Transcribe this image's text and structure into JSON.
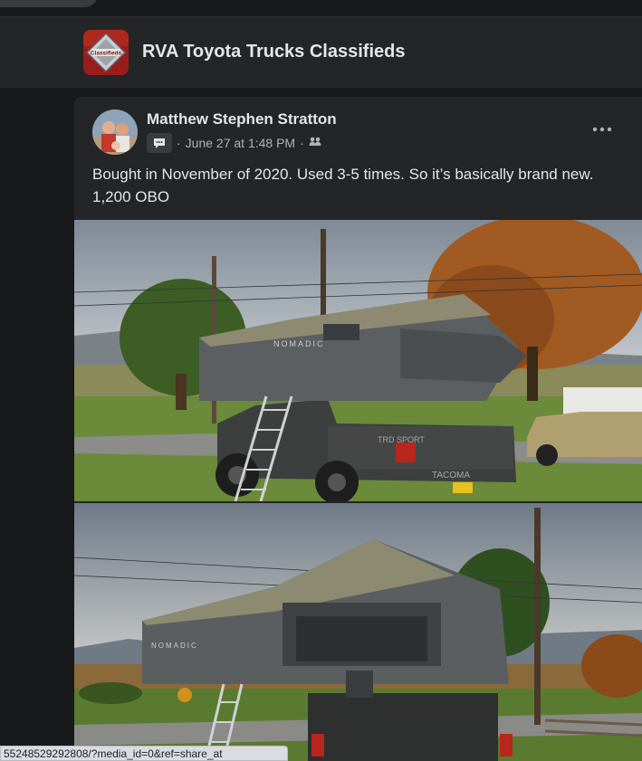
{
  "group": {
    "name": "RVA Toyota Trucks Classifieds",
    "avatar_label": "Classifieds"
  },
  "post": {
    "author": "Matthew Stephen Stratton",
    "timestamp": "June 27 at 1:48 PM",
    "separator": "·",
    "body": "Bought in November of 2020. Used 3-5 times. So it’s basically brand new. 1,200 OBO",
    "photos": [
      {
        "subject": "rooftop-tent-on-truck-side-view"
      },
      {
        "subject": "rooftop-tent-on-truck-rear-view"
      }
    ]
  },
  "photo_text": {
    "tent_brand": "NOMADIC",
    "truck_badge": "TRD SPORT",
    "tailgate": "TACOMA"
  },
  "status_bar": {
    "url": "55248529292808/?media_id=0&ref=share_at"
  },
  "colors": {
    "background": "#18191a",
    "card": "#242526",
    "text_primary": "#e4e6eb",
    "text_secondary": "#b0b3b8"
  }
}
